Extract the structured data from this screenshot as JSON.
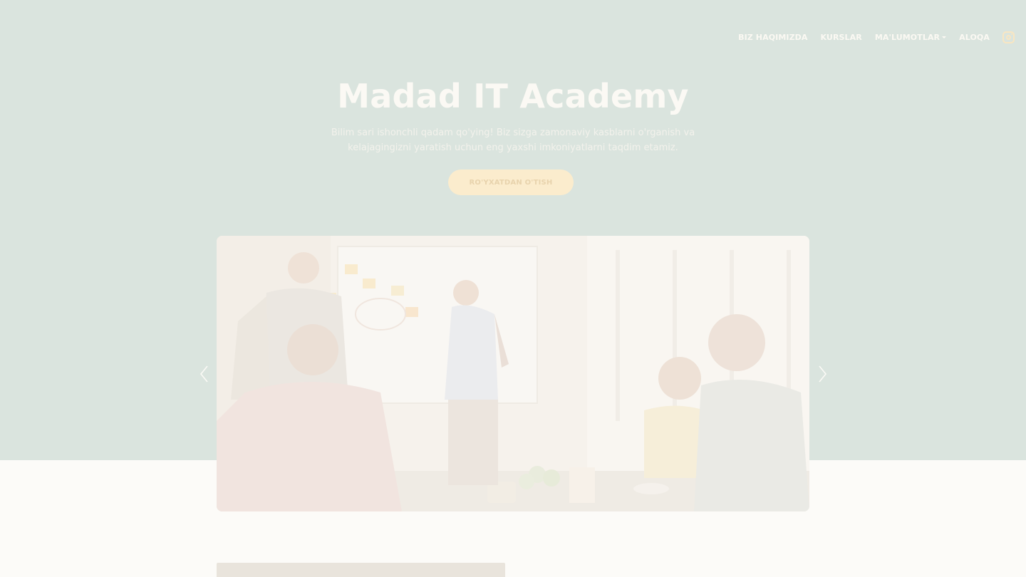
{
  "nav": {
    "items": [
      {
        "label": "BIZ HAQIMIZDA",
        "dropdown": false
      },
      {
        "label": "KURSLAR",
        "dropdown": false
      },
      {
        "label": "MA'LUMOTLAR",
        "dropdown": true
      },
      {
        "label": "ALOQA",
        "dropdown": false
      }
    ],
    "social_icon": "instagram-icon"
  },
  "hero": {
    "title": "Madad IT Academy",
    "subtitle": "Bilim sari ishonchli qadam qo'ying! Biz sizga zamonaviy kasblarni o'rganish va kelajagingizni yaratish uchun eng yaxshi imkoniyatlarni taqdim etamiz.",
    "cta_label": "RO'YXATDAN O'TISH"
  },
  "carousel": {
    "prev_icon": "chevron-left-icon",
    "next_icon": "chevron-right-icon",
    "slide_image": "team-meeting-whiteboard-photo"
  },
  "colors": {
    "hero_background": "#dae4de",
    "page_background": "#fcfbf8",
    "nav_text": "#fbf9f3",
    "cta_background": "#fbeccd",
    "cta_text": "#e8d3ad",
    "instagram_icon": "#f9e6c2"
  }
}
